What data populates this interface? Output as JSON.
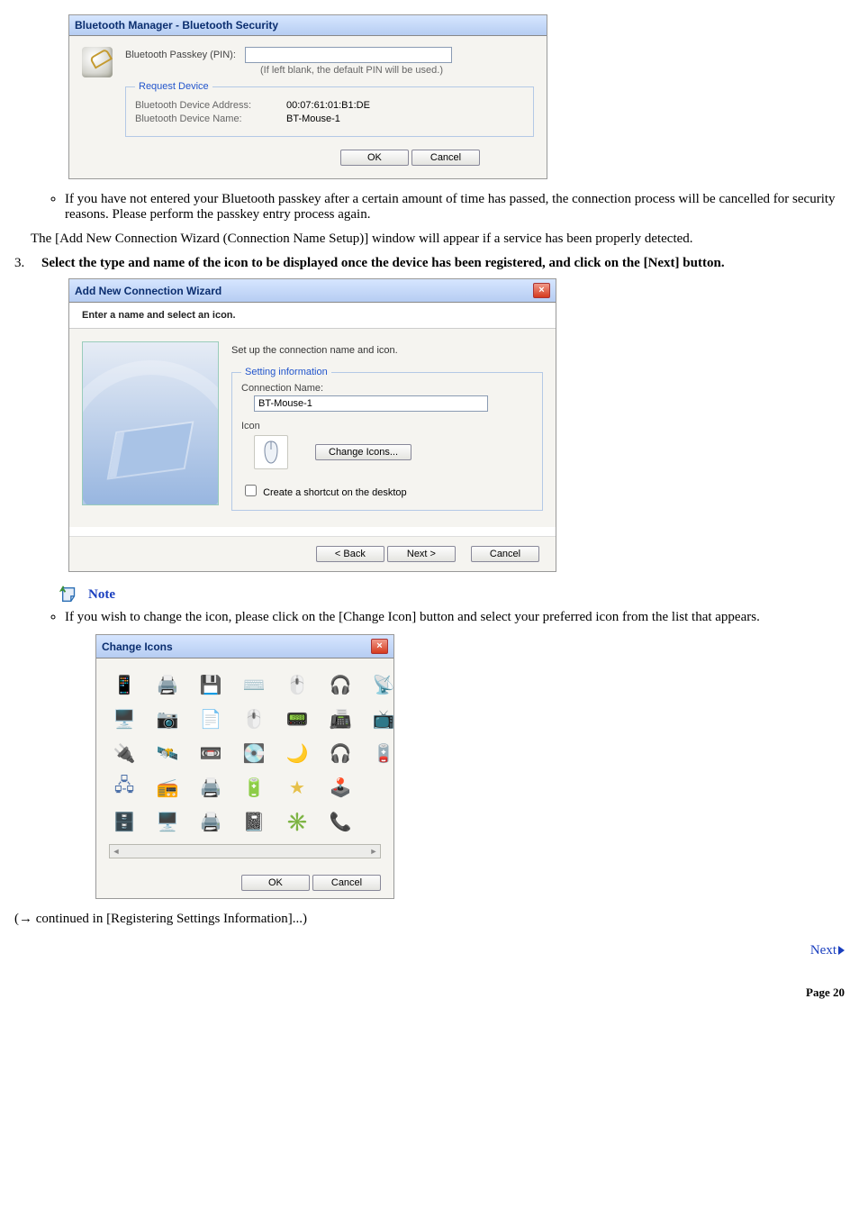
{
  "dlg1": {
    "title": "Bluetooth Manager - Bluetooth Security",
    "passkey_label": "Bluetooth Passkey (PIN):",
    "passkey_value": "",
    "passkey_hint": "(If left blank, the default PIN will be used.)",
    "group_title": "Request Device",
    "addr_label": "Bluetooth Device Address:",
    "addr_value": "00:07:61:01:B1:DE",
    "name_label": "Bluetooth Device Name:",
    "name_value": "BT-Mouse-1",
    "ok": "OK",
    "cancel": "Cancel"
  },
  "bullet_timeout": "If you have not entered your Bluetooth passkey after a certain amount of time has passed, the connection process will be cancelled for security reasons. Please perform the passkey entry process again.",
  "wizard_line": "The [Add New Connection Wizard (Connection Name Setup)] window will appear if a service has been properly detected.",
  "step3": {
    "num": "3.",
    "text": "Select the type and name of the icon to be displayed once the device has been registered, and click on the [Next] button."
  },
  "dlg2": {
    "title": "Add New Connection Wizard",
    "subtitle": "Enter a name and select an icon.",
    "instr": "Set up the connection name and icon.",
    "group": "Setting information",
    "conn_label": "Connection Name:",
    "conn_value": "BT-Mouse-1",
    "icon_label": "Icon",
    "change_btn": "Change Icons...",
    "shortcut_cb": "Create a shortcut on the desktop",
    "back": "< Back",
    "next": "Next >",
    "cancel": "Cancel"
  },
  "note_label": "Note",
  "bullet_changeicon": "If you wish to change the icon, please click on the [Change Icon] button and select your preferred icon from the list that appears.",
  "dlg3": {
    "title": "Change Icons",
    "ok": "OK",
    "cancel": "Cancel"
  },
  "continued": "(→ continued in [Registering Settings Information]...)",
  "next_nav": "Next",
  "page_footer": "Page 20"
}
